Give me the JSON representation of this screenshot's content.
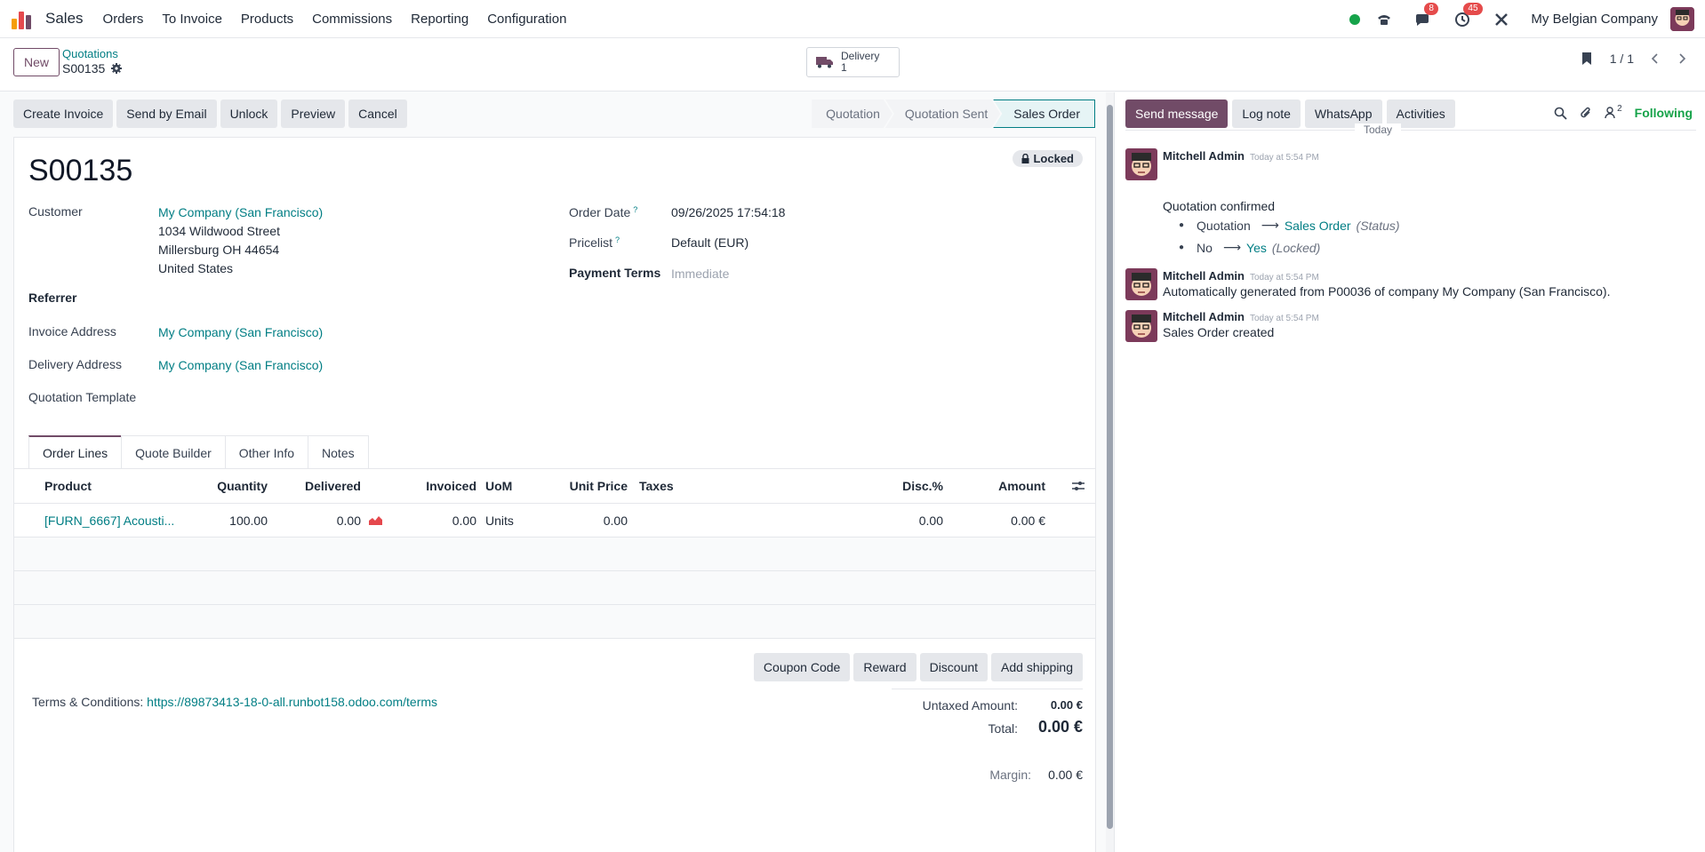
{
  "navbar": {
    "app_name": "Sales",
    "menus": [
      "Orders",
      "To Invoice",
      "Products",
      "Commissions",
      "Reporting",
      "Configuration"
    ],
    "chat_badge": "8",
    "activity_badge": "45",
    "company": "My Belgian Company"
  },
  "cpanel": {
    "new_label": "New",
    "breadcrumb_parent": "Quotations",
    "breadcrumb_current": "S00135",
    "smart_delivery_label": "Delivery",
    "smart_delivery_count": "1",
    "pager": "1 / 1"
  },
  "actions": {
    "create_invoice": "Create Invoice",
    "send_email": "Send by Email",
    "unlock": "Unlock",
    "preview": "Preview",
    "cancel": "Cancel"
  },
  "stages": [
    "Quotation",
    "Quotation Sent",
    "Sales Order"
  ],
  "form": {
    "locked": "Locked",
    "name": "S00135",
    "customer_label": "Customer",
    "customer_value": "My Company (San Francisco)",
    "addr1": "1034 Wildwood Street",
    "addr2": "Millersburg OH 44654",
    "addr3": "United States",
    "referrer_label": "Referrer",
    "invoice_addr_label": "Invoice Address",
    "invoice_addr_value": "My Company (San Francisco)",
    "delivery_addr_label": "Delivery Address",
    "delivery_addr_value": "My Company (San Francisco)",
    "template_label": "Quotation Template",
    "order_date_label": "Order Date",
    "order_date_value": "09/26/2025 17:54:18",
    "pricelist_label": "Pricelist",
    "pricelist_value": "Default (EUR)",
    "payment_terms_label": "Payment Terms",
    "payment_terms_value": "Immediate",
    "help_mark": "?"
  },
  "tabs": [
    "Order Lines",
    "Quote Builder",
    "Other Info",
    "Notes"
  ],
  "lines": {
    "headers": {
      "product": "Product",
      "quantity": "Quantity",
      "delivered": "Delivered",
      "invoiced": "Invoiced",
      "uom": "UoM",
      "unit_price": "Unit Price",
      "taxes": "Taxes",
      "disc": "Disc.%",
      "amount": "Amount"
    },
    "row": {
      "product": "[FURN_6667] Acousti...",
      "quantity": "100.00",
      "delivered": "0.00",
      "invoiced": "0.00",
      "uom": "Units",
      "unit_price": "0.00",
      "disc": "0.00",
      "amount": "0.00 €"
    }
  },
  "bottom_buttons": {
    "coupon": "Coupon Code",
    "reward": "Reward",
    "discount": "Discount",
    "shipping": "Add shipping"
  },
  "terms": {
    "label": "Terms & Conditions:",
    "url": "https://89873413-18-0-all.runbot158.odoo.com/terms"
  },
  "totals": {
    "untaxed_label": "Untaxed Amount:",
    "untaxed_value": "0.00 €",
    "total_label": "Total:",
    "total_value": "0.00 €",
    "margin_label": "Margin:",
    "margin_value": "0.00 €"
  },
  "chatter": {
    "send_message": "Send message",
    "log_note": "Log note",
    "whatsapp": "WhatsApp",
    "activities": "Activities",
    "followers_count": "2",
    "following": "Following",
    "date_sep": "Today",
    "messages": [
      {
        "author": "Mitchell Admin",
        "time": "Today at 5:54 PM",
        "body": "Quotation confirmed",
        "changes": [
          {
            "old": "Quotation",
            "new": "Sales Order",
            "field": "(Status)"
          },
          {
            "old": "No",
            "new": "Yes",
            "field": "(Locked)"
          }
        ]
      },
      {
        "author": "Mitchell Admin",
        "time": "Today at 5:54 PM",
        "body": "Automatically generated from P00036 of company My Company (San Francisco)."
      },
      {
        "author": "Mitchell Admin",
        "time": "Today at 5:54 PM",
        "body": "Sales Order created"
      }
    ]
  },
  "colors": {
    "brand": "#714b67",
    "link": "#017e84",
    "badge": "#e54b4b",
    "online": "#16a34a"
  }
}
